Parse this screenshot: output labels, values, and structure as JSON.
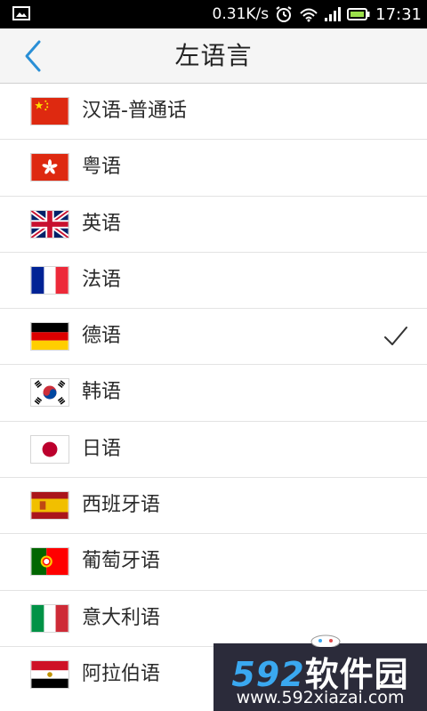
{
  "status_bar": {
    "net_speed": "0.31K/s",
    "time": "17:31",
    "icons": [
      "image-notification-icon",
      "alarm-clock-icon",
      "wifi-icon",
      "signal-icon",
      "battery-icon"
    ]
  },
  "header": {
    "title": "左语言",
    "back_icon": "chevron-left-icon"
  },
  "languages": [
    {
      "label": "汉语-普通话",
      "flag": "china",
      "selected": false
    },
    {
      "label": "粤语",
      "flag": "hong-kong",
      "selected": false
    },
    {
      "label": "英语",
      "flag": "uk",
      "selected": false
    },
    {
      "label": "法语",
      "flag": "france",
      "selected": false
    },
    {
      "label": "德语",
      "flag": "germany",
      "selected": true
    },
    {
      "label": "韩语",
      "flag": "korea",
      "selected": false
    },
    {
      "label": "日语",
      "flag": "japan",
      "selected": false
    },
    {
      "label": "西班牙语",
      "flag": "spain",
      "selected": false
    },
    {
      "label": "葡萄牙语",
      "flag": "portugal",
      "selected": false
    },
    {
      "label": "意大利语",
      "flag": "italy",
      "selected": false
    },
    {
      "label": "阿拉伯语",
      "flag": "egypt",
      "selected": false
    }
  ],
  "watermark": {
    "brand_num": "592",
    "brand_cn": "软件园",
    "url": "www.592xiazai.com"
  },
  "colors": {
    "accent": "#2a8fd6",
    "status_bar": "#000000",
    "title_bar": "#f5f5f5",
    "divider": "#e3e3e3"
  }
}
